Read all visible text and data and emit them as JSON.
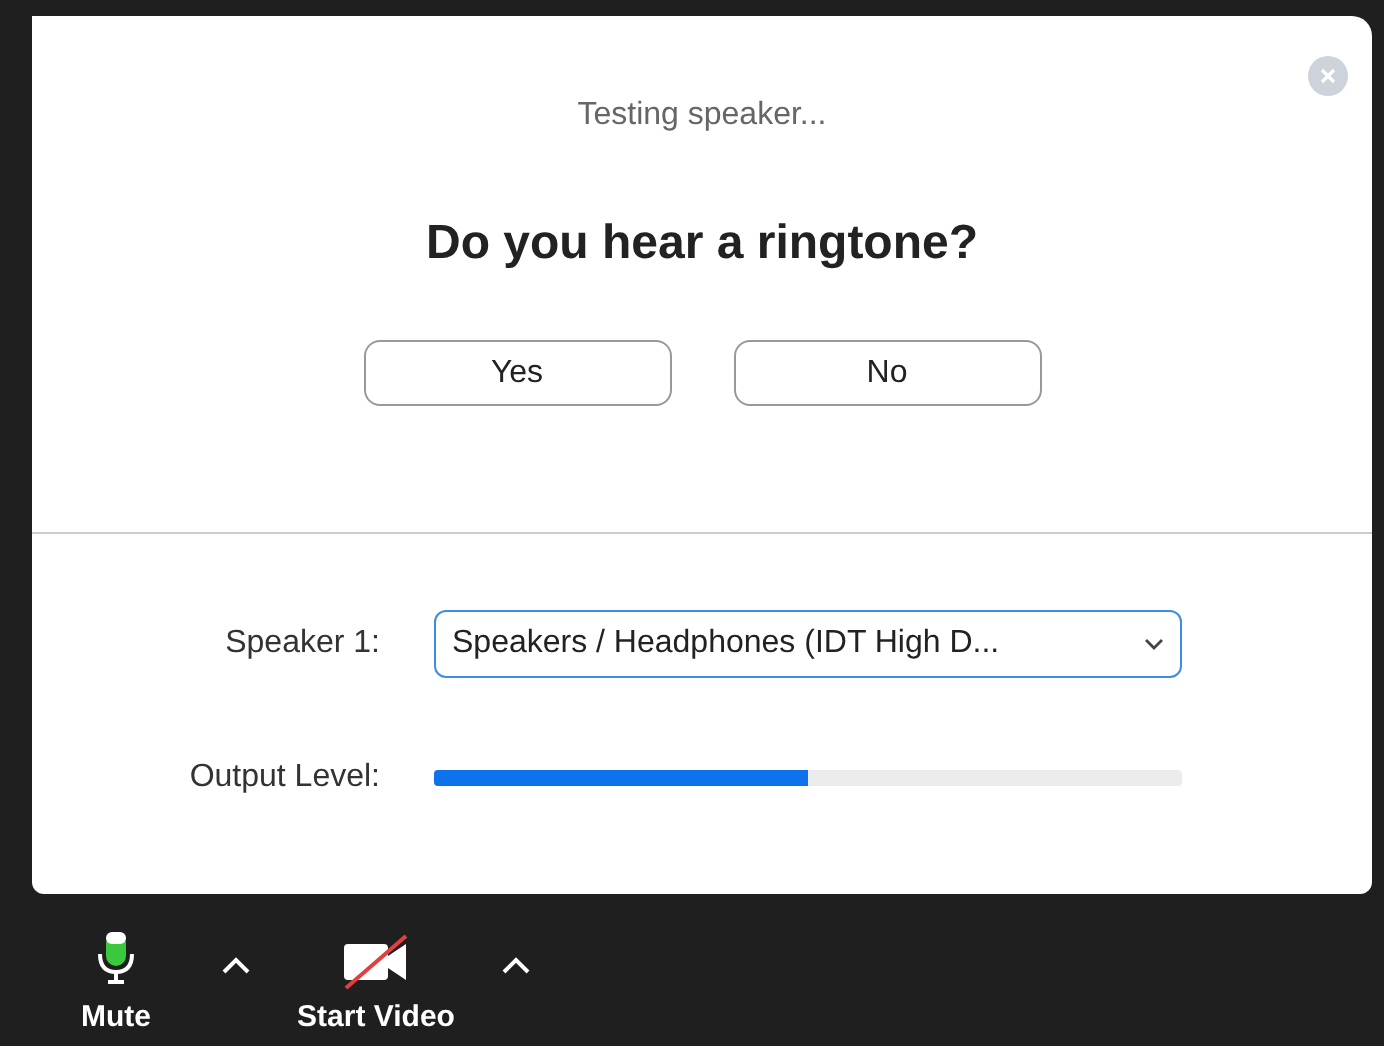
{
  "dialog": {
    "status": "Testing speaker...",
    "question": "Do you hear a ringtone?",
    "buttons": [
      "Yes",
      "No"
    ],
    "speaker": {
      "label": "Speaker 1:",
      "value": "Speakers / Headphones (IDT High D..."
    },
    "output": {
      "label": "Output Level:",
      "level": 0.5
    }
  },
  "toolbar": [
    {
      "kind": "mic",
      "label": "Mute"
    },
    {
      "kind": "caret"
    },
    {
      "kind": "video",
      "label": "Start Video"
    },
    {
      "kind": "caret"
    }
  ]
}
